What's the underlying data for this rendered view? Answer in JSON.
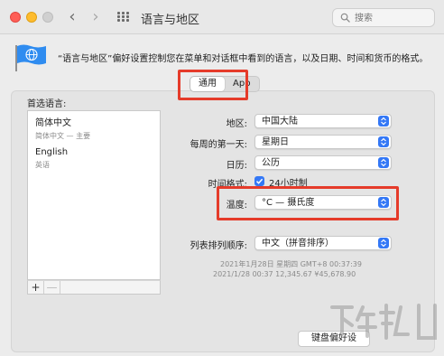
{
  "window": {
    "title": "语言与地区",
    "search_placeholder": "搜索"
  },
  "description": "“语言与地区”偏好设置控制您在菜单和对话框中看到的语言，以及日期、时间和货币的格式。",
  "tabs": [
    {
      "label": "通用",
      "active": true
    },
    {
      "label": "App",
      "active": false
    }
  ],
  "preferred_languages": {
    "label": "首选语言:",
    "items": [
      {
        "name": "简体中文",
        "detail": "简体中文 — 主要"
      },
      {
        "name": "English",
        "detail": "英语"
      }
    ],
    "add_label": "+",
    "remove_label": "—"
  },
  "settings": {
    "region": {
      "label": "地区:",
      "value": "中国大陆"
    },
    "first_day": {
      "label": "每周的第一天:",
      "value": "星期日"
    },
    "calendar": {
      "label": "日历:",
      "value": "公历"
    },
    "time_format": {
      "label": "时间格式:",
      "value": "24小时制",
      "checked": true
    },
    "temperature": {
      "label": "温度:",
      "value": "°C — 摄氏度"
    },
    "list_sort": {
      "label": "列表排列顺序:",
      "value": "中文（拼音排序）"
    }
  },
  "sample": {
    "line1": "2021年1月28日 星期四 GMT+8 00:37:39",
    "line2": "2021/1/28 00:37      12,345.67      ¥45,678.90"
  },
  "keyboard_button": "键盘偏好设",
  "colors": {
    "accent": "#3478f6",
    "highlight": "#e53b2a"
  }
}
